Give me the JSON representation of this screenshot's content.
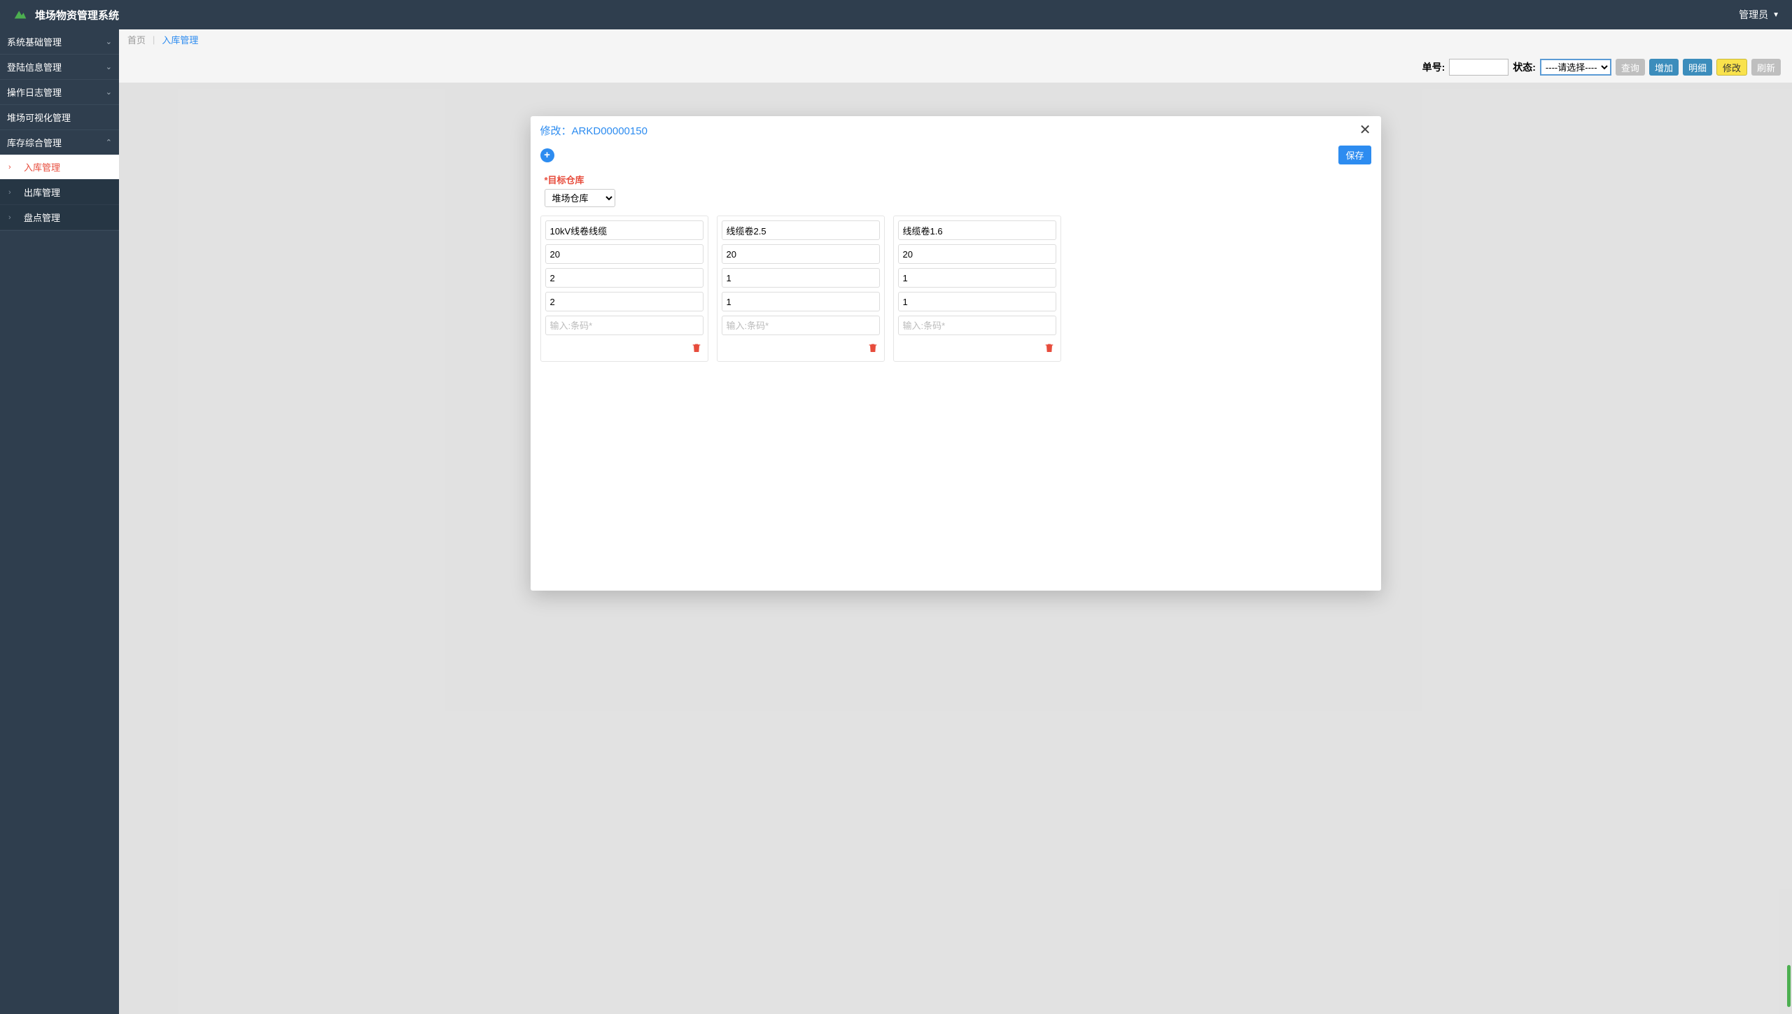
{
  "header": {
    "app_title": "堆场物资管理系统",
    "user_label": "管理员"
  },
  "sidebar": {
    "groups": [
      {
        "label": "系统基础管理",
        "expanded": false,
        "chevron": "down"
      },
      {
        "label": "登陆信息管理",
        "expanded": false,
        "chevron": "down"
      },
      {
        "label": "操作日志管理",
        "expanded": false,
        "chevron": "down"
      },
      {
        "label": "堆场可视化管理",
        "expanded": false,
        "chevron": "none"
      },
      {
        "label": "库存综合管理",
        "expanded": true,
        "chevron": "up"
      }
    ],
    "sub_items": [
      {
        "label": "入库管理",
        "active": true
      },
      {
        "label": "出库管理",
        "active": false
      },
      {
        "label": "盘点管理",
        "active": false
      }
    ]
  },
  "breadcrumb": {
    "home": "首页",
    "sep": "|",
    "current": "入库管理"
  },
  "toolbar": {
    "order_label": "单号:",
    "status_label": "状态:",
    "status_placeholder": "----请选择----",
    "query": "查询",
    "add": "增加",
    "detail": "明细",
    "edit": "修改",
    "refresh": "刷新"
  },
  "modal": {
    "title_prefix": "修改：",
    "record_id": "ARKD00000150",
    "save": "保存",
    "target_label": "*目标仓库",
    "target_value": "堆场仓库",
    "barcode_placeholder": "输入:条码*",
    "cards": [
      {
        "name": "10kV线卷线缆",
        "f1": "20",
        "f2": "2",
        "f3": "2",
        "barcode": ""
      },
      {
        "name": "线缆卷2.5",
        "f1": "20",
        "f2": "1",
        "f3": "1",
        "barcode": ""
      },
      {
        "name": "线缆卷1.6",
        "f1": "20",
        "f2": "1",
        "f3": "1",
        "barcode": ""
      }
    ]
  }
}
